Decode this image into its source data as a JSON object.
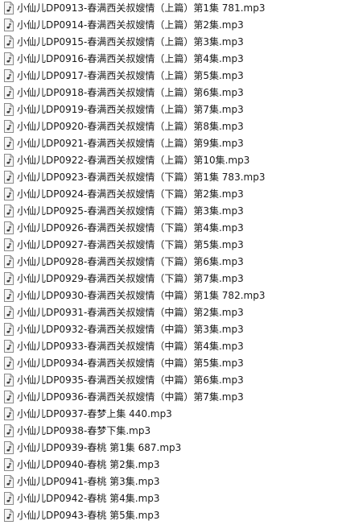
{
  "colors": {
    "background": "#ffffff",
    "text": "#1a1a1a",
    "icon_border": "#8a8a8a",
    "icon_fill": "#f4f4f4",
    "icon_glyph": "#3b3b3b"
  },
  "files": [
    {
      "name": "小仙儿DP0913-春满西关叔嫂情（上篇）第1集 781.mp3",
      "icon": "audio-file-icon"
    },
    {
      "name": "小仙儿DP0914-春满西关叔嫂情（上篇）第2集.mp3",
      "icon": "audio-file-icon"
    },
    {
      "name": "小仙儿DP0915-春满西关叔嫂情（上篇）第3集.mp3",
      "icon": "audio-file-icon"
    },
    {
      "name": "小仙儿DP0916-春满西关叔嫂情（上篇）第4集.mp3",
      "icon": "audio-file-icon"
    },
    {
      "name": "小仙儿DP0917-春满西关叔嫂情（上篇）第5集.mp3",
      "icon": "audio-file-icon"
    },
    {
      "name": "小仙儿DP0918-春满西关叔嫂情（上篇）第6集.mp3",
      "icon": "audio-file-icon"
    },
    {
      "name": "小仙儿DP0919-春满西关叔嫂情（上篇）第7集.mp3",
      "icon": "audio-file-icon"
    },
    {
      "name": "小仙儿DP0920-春满西关叔嫂情（上篇）第8集.mp3",
      "icon": "audio-file-icon"
    },
    {
      "name": "小仙儿DP0921-春满西关叔嫂情（上篇）第9集.mp3",
      "icon": "audio-file-icon"
    },
    {
      "name": "小仙儿DP0922-春满西关叔嫂情（上篇）第10集.mp3",
      "icon": "audio-file-icon"
    },
    {
      "name": "小仙儿DP0923-春满西关叔嫂情（下篇）第1集 783.mp3",
      "icon": "audio-file-icon"
    },
    {
      "name": "小仙儿DP0924-春满西关叔嫂情（下篇）第2集.mp3",
      "icon": "audio-file-icon"
    },
    {
      "name": "小仙儿DP0925-春满西关叔嫂情（下篇）第3集.mp3",
      "icon": "audio-file-icon"
    },
    {
      "name": "小仙儿DP0926-春满西关叔嫂情（下篇）第4集.mp3",
      "icon": "audio-file-icon"
    },
    {
      "name": "小仙儿DP0927-春满西关叔嫂情（下篇）第5集.mp3",
      "icon": "audio-file-icon"
    },
    {
      "name": "小仙儿DP0928-春满西关叔嫂情（下篇）第6集.mp3",
      "icon": "audio-file-icon"
    },
    {
      "name": "小仙儿DP0929-春满西关叔嫂情（下篇）第7集.mp3",
      "icon": "audio-file-icon"
    },
    {
      "name": "小仙儿DP0930-春满西关叔嫂情（中篇）第1集 782.mp3",
      "icon": "audio-file-icon"
    },
    {
      "name": "小仙儿DP0931-春满西关叔嫂情（中篇）第2集.mp3",
      "icon": "audio-file-icon"
    },
    {
      "name": "小仙儿DP0932-春满西关叔嫂情（中篇）第3集.mp3",
      "icon": "audio-file-icon"
    },
    {
      "name": "小仙儿DP0933-春满西关叔嫂情（中篇）第4集.mp3",
      "icon": "audio-file-icon"
    },
    {
      "name": "小仙儿DP0934-春满西关叔嫂情（中篇）第5集.mp3",
      "icon": "audio-file-icon"
    },
    {
      "name": "小仙儿DP0935-春满西关叔嫂情（中篇）第6集.mp3",
      "icon": "audio-file-icon"
    },
    {
      "name": "小仙儿DP0936-春满西关叔嫂情（中篇）第7集.mp3",
      "icon": "audio-file-icon"
    },
    {
      "name": "小仙儿DP0937-春梦上集 440.mp3",
      "icon": "audio-file-icon"
    },
    {
      "name": "小仙儿DP0938-春梦下集.mp3",
      "icon": "audio-file-icon"
    },
    {
      "name": "小仙儿DP0939-春桃 第1集 687.mp3",
      "icon": "audio-file-icon"
    },
    {
      "name": "小仙儿DP0940-春桃 第2集.mp3",
      "icon": "audio-file-icon"
    },
    {
      "name": "小仙儿DP0941-春桃 第3集.mp3",
      "icon": "audio-file-icon"
    },
    {
      "name": "小仙儿DP0942-春桃 第4集.mp3",
      "icon": "audio-file-icon"
    },
    {
      "name": "小仙儿DP0943-春桃 第5集.mp3",
      "icon": "audio-file-icon"
    }
  ]
}
